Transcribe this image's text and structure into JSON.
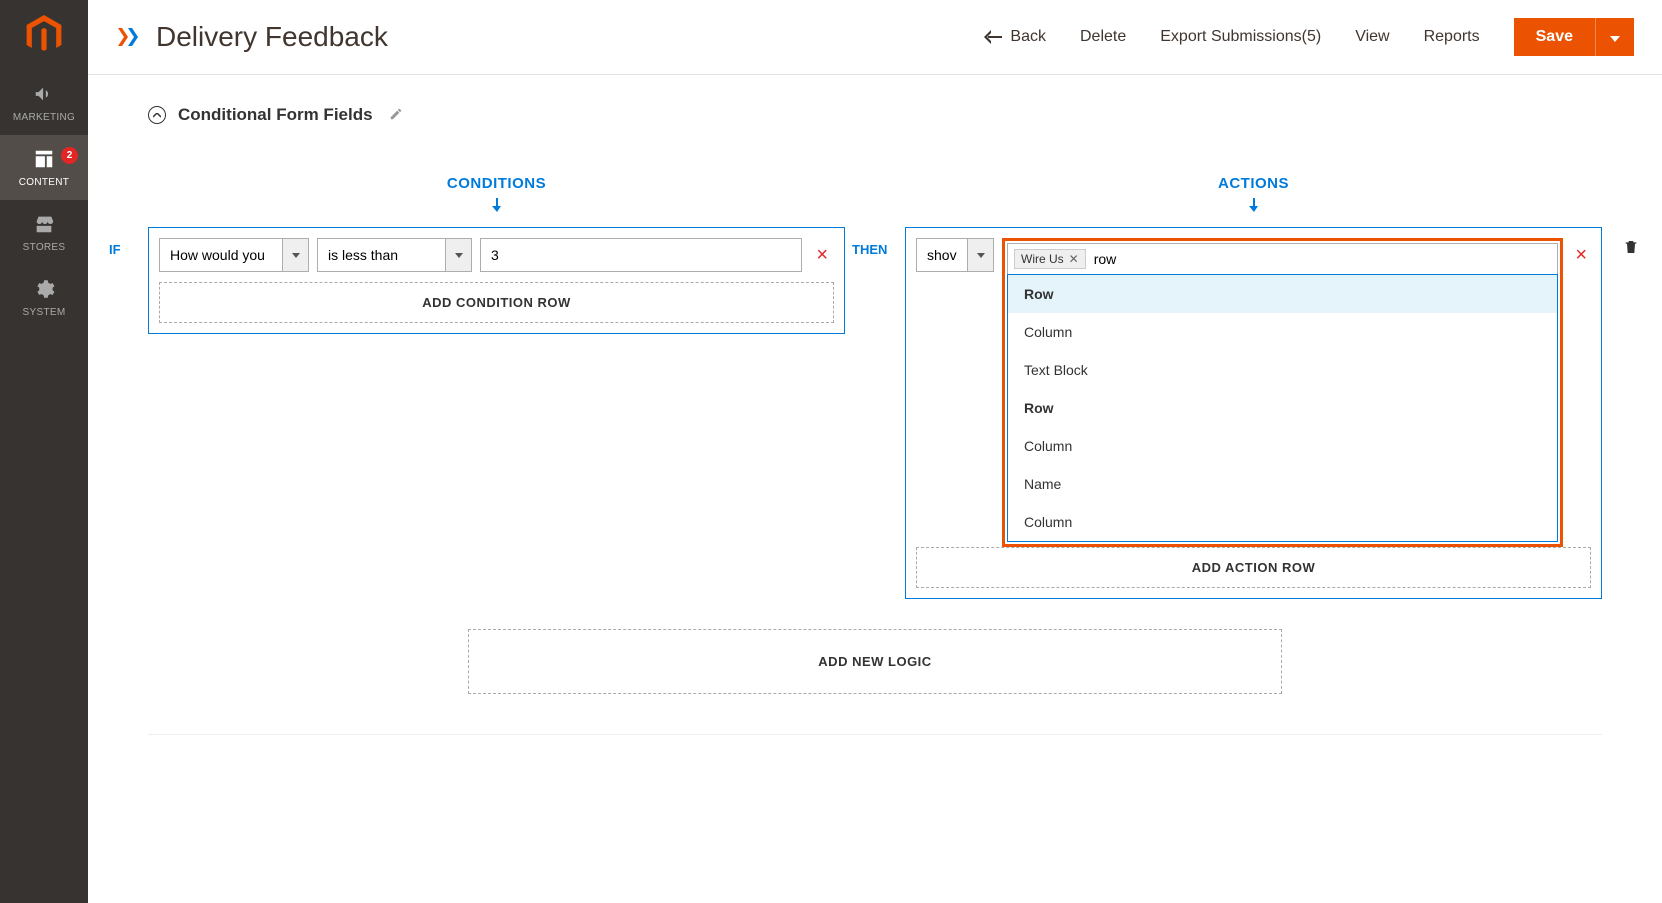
{
  "sidebar": {
    "items": [
      {
        "label": "MARKETING"
      },
      {
        "label": "CONTENT",
        "badge": "2"
      },
      {
        "label": "STORES"
      },
      {
        "label": "SYSTEM"
      }
    ]
  },
  "header": {
    "title": "Delivery Feedback",
    "back": "Back",
    "delete": "Delete",
    "export": "Export Submissions(5)",
    "view": "View",
    "reports": "Reports",
    "save": "Save"
  },
  "section": {
    "title": "Conditional Form Fields"
  },
  "conditions": {
    "header": "CONDITIONS",
    "prefix": "IF",
    "row": {
      "field": "How would you",
      "operator": "is less than",
      "value": "3"
    },
    "add_row": "ADD CONDITION ROW"
  },
  "actions": {
    "header": "ACTIONS",
    "prefix": "THEN",
    "row": {
      "action": "shov",
      "tag": "Wire Us",
      "search": "row"
    },
    "dropdown": [
      {
        "label": "Row",
        "highlighted": true
      },
      {
        "label": "Column"
      },
      {
        "label": "Text Block"
      },
      {
        "label": "Row",
        "bold": true
      },
      {
        "label": "Column"
      },
      {
        "label": "Name"
      },
      {
        "label": "Column"
      }
    ],
    "add_row": "ADD ACTION ROW"
  },
  "add_logic": "ADD NEW LOGIC"
}
